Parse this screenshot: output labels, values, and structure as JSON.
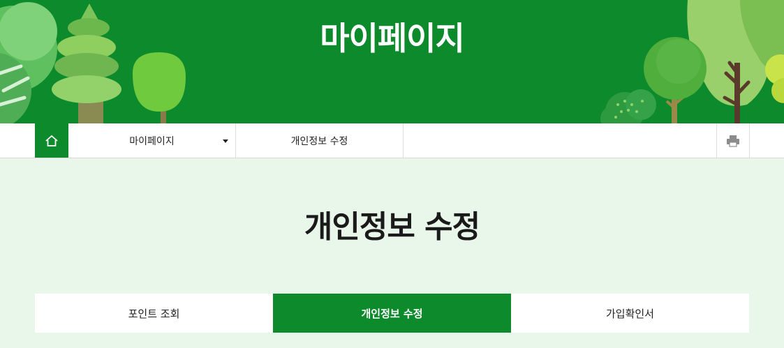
{
  "banner": {
    "title": "마이페이지"
  },
  "location_bar": {
    "home_icon": "home-icon",
    "items": [
      {
        "label": "마이페이지",
        "has_dropdown": true
      },
      {
        "label": "개인정보 수정",
        "has_dropdown": false
      }
    ],
    "print_icon": "print-icon"
  },
  "page": {
    "title": "개인정보 수정"
  },
  "tabs": [
    {
      "label": "포인트 조회",
      "active": false
    },
    {
      "label": "개인정보 수정",
      "active": true
    },
    {
      "label": "가입확인서",
      "active": false
    }
  ],
  "colors": {
    "brand_green": "#0d8a2c",
    "page_background": "#e9f6ea",
    "tab_active_text": "#ffffff"
  }
}
